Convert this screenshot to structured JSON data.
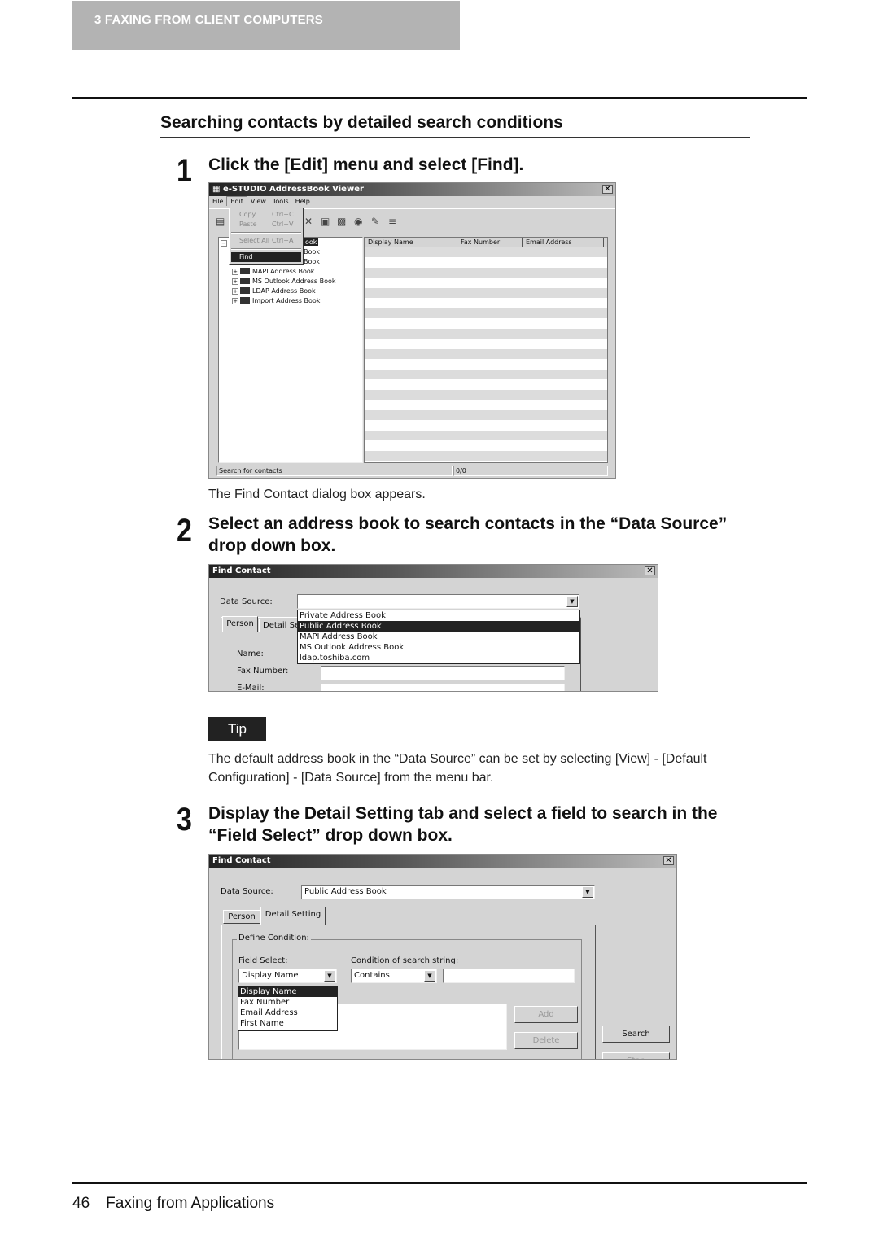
{
  "header": {
    "chapter_label": "3   FAXING FROM CLIENT COMPUTERS"
  },
  "section": {
    "title": "Searching contacts by detailed search conditions"
  },
  "steps": [
    {
      "number": "1",
      "text": "Click the [Edit] menu and select [Find].",
      "result": "The Find Contact dialog box appears."
    },
    {
      "number": "2",
      "text_line1": "Select an address book to search contacts in the “Data Source”",
      "text_line2": "drop down box."
    },
    {
      "number": "3",
      "text_line1": "Display the Detail Setting tab and select a field to search in the",
      "text_line2": "“Field Select” drop down box."
    }
  ],
  "tip": {
    "label": "Tip",
    "line1": "The default address book in the “Data Source” can be set by selecting [View] - [Default",
    "line2": "Configuration] - [Data Source] from the menu bar."
  },
  "viewer": {
    "title": "e-STUDIO AddressBook Viewer",
    "close": "✕",
    "menus": [
      "File",
      "Edit",
      "View",
      "Tools",
      "Help"
    ],
    "edit_menu": [
      {
        "label": "Copy",
        "shortcut": "Ctrl+C",
        "enabled": false
      },
      {
        "label": "Paste",
        "shortcut": "Ctrl+V",
        "enabled": false
      },
      {
        "label": "Select All",
        "shortcut": "Ctrl+A",
        "enabled": false
      },
      {
        "label": "Find",
        "shortcut": "",
        "enabled": true,
        "highlighted": true
      }
    ],
    "toolbar_icons": [
      "address-book-icon",
      "delete-icon",
      "private-book-icon",
      "public-book-icon",
      "sync-icon",
      "edit-icon",
      "list-icon"
    ],
    "tree": {
      "collapse_symbol": "−",
      "expand_symbol": "+",
      "root_partial": "ook",
      "items_partial": [
        "Book",
        "Book"
      ],
      "items": [
        "MAPI Address Book",
        "MS Outlook Address Book",
        "LDAP Address Book",
        "Import Address Book"
      ]
    },
    "columns": [
      "Display Name",
      "Fax Number",
      "Email Address"
    ],
    "status_left": "Search for contacts",
    "status_right": "0/0"
  },
  "find_contact_1": {
    "title": "Find Contact",
    "close": "✕",
    "data_source_label": "Data Source:",
    "data_source_value": "",
    "tabs": [
      "Person",
      "Detail Se"
    ],
    "options": [
      "Private Address Book",
      "Public Address Book",
      "MAPI Address Book",
      "MS Outlook Address Book",
      "ldap.toshiba.com"
    ],
    "selected_option": "Public Address Book",
    "fields": [
      "Name:",
      "Fax Number:",
      "E-Mail:"
    ]
  },
  "find_contact_2": {
    "title": "Find Contact",
    "close": "✕",
    "data_source_label": "Data Source:",
    "data_source_value": "Public Address Book",
    "tabs": [
      "Person",
      "Detail Setting"
    ],
    "group_label": "Define Condition:",
    "field_select_label": "Field Select:",
    "field_select_value": "Display Name",
    "condition_label": "Condition of search string:",
    "condition_value": "Contains",
    "search_string": "",
    "field_options": [
      "Display Name",
      "Fax Number",
      "Email Address",
      "First Name"
    ],
    "selected_field": "Display Name",
    "add_label": "Add",
    "delete_label": "Delete",
    "search_label": "Search",
    "stop_label": "Stop"
  },
  "footer": {
    "page_number": "46",
    "title": "Faxing from Applications"
  }
}
